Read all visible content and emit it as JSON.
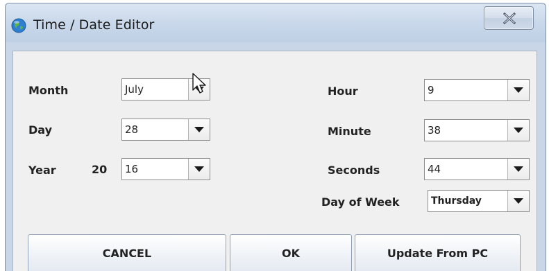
{
  "window": {
    "title": "Time / Date Editor",
    "close_icon": "close-x-icon",
    "app_icon": "globe-icon"
  },
  "date": {
    "month_label": "Month",
    "month_value": "July",
    "day_label": "Day",
    "day_value": "28",
    "year_label": "Year",
    "year_prefix": "20",
    "year_value": "16"
  },
  "time": {
    "hour_label": "Hour",
    "hour_value": "9",
    "minute_label": "Minute",
    "minute_value": "38",
    "seconds_label": "Seconds",
    "seconds_value": "44",
    "dow_label": "Day of Week",
    "dow_value": "Thursday"
  },
  "buttons": {
    "cancel": "CANCEL",
    "ok": "OK",
    "update": "Update From PC"
  },
  "colors": {
    "titlebar": "#c9d8ea",
    "client_bg": "#f0f0f0",
    "combo_border": "#8c8c8c"
  },
  "icons": {
    "dropdown": "chevron-down-icon",
    "pointer": "mouse-pointer-icon"
  }
}
